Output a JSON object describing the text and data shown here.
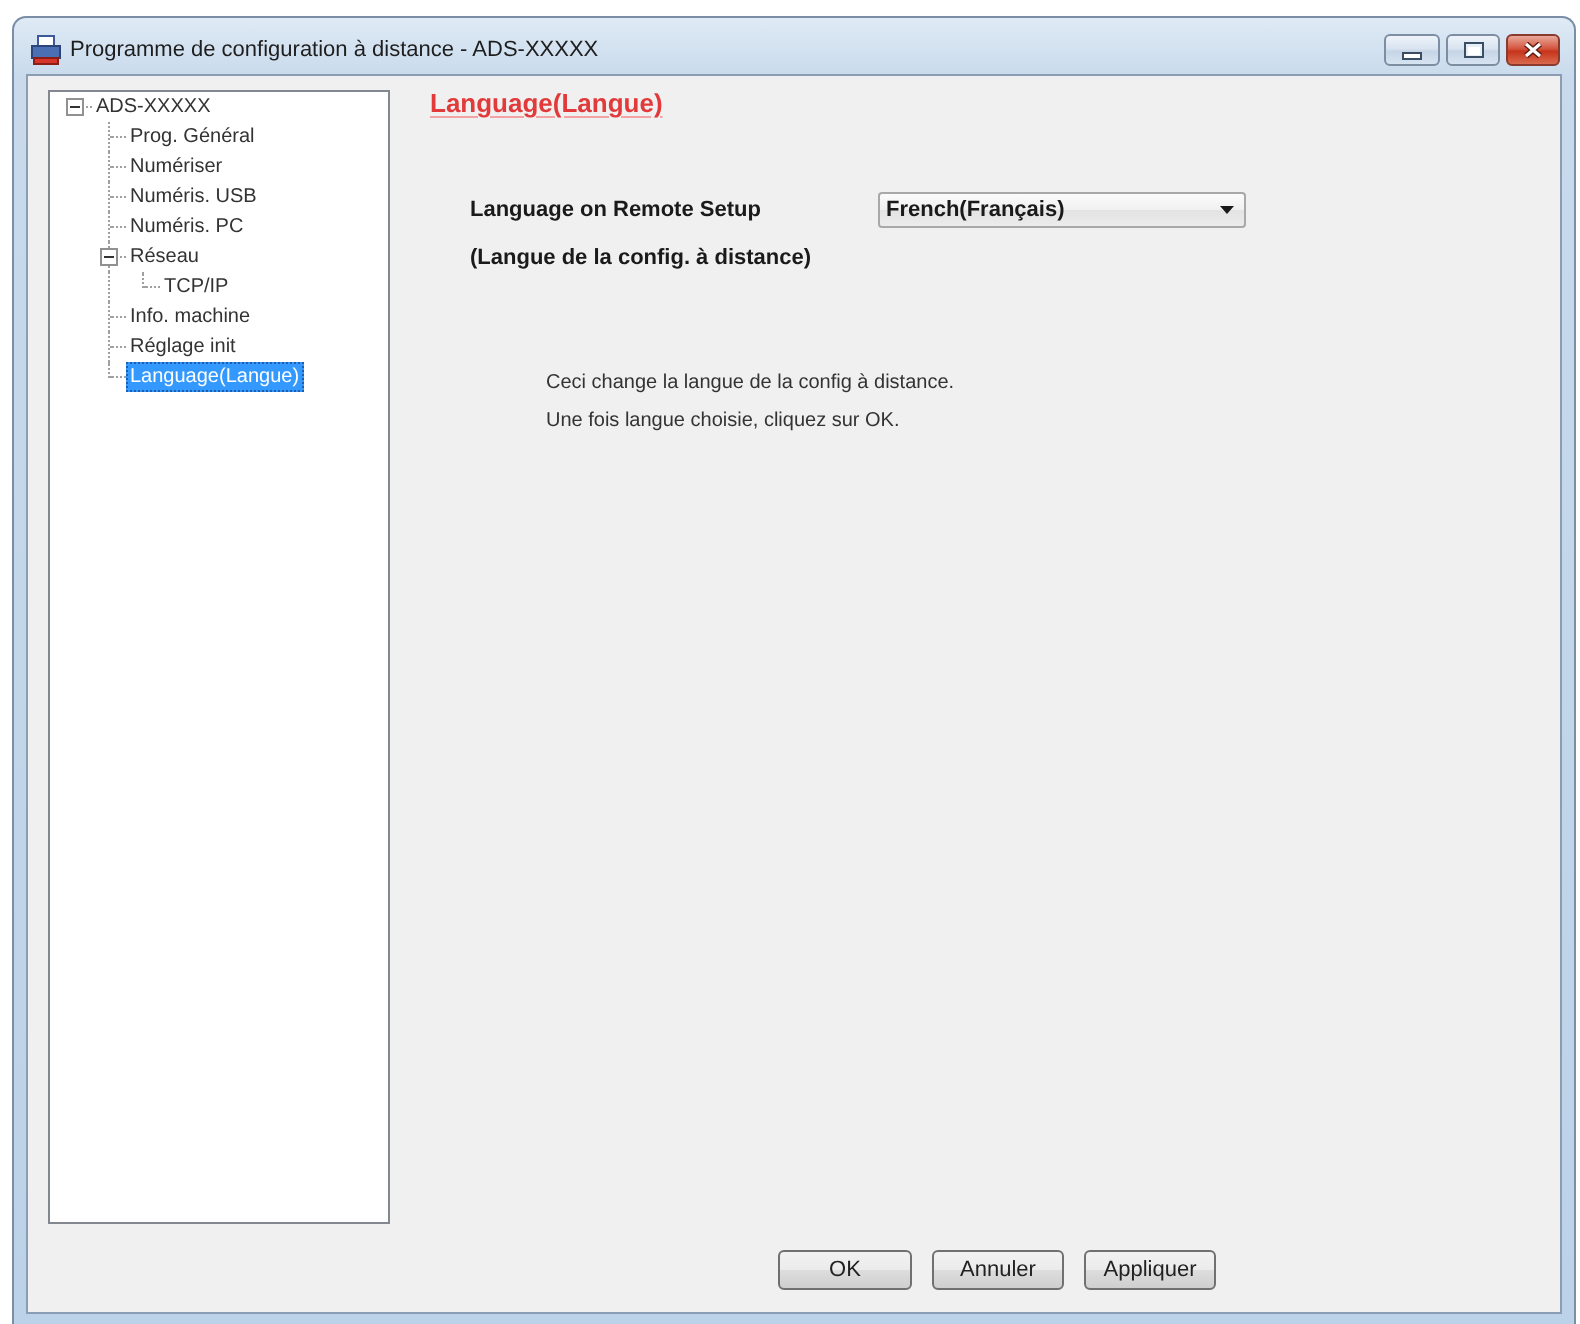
{
  "window": {
    "title": "Programme de configuration à distance - ADS-XXXXX"
  },
  "tree": [
    {
      "label": "ADS-XXXXX",
      "selected": false,
      "expanded": true,
      "children": [
        {
          "label": "Prog. Général",
          "selected": false
        },
        {
          "label": "Numériser",
          "selected": false
        },
        {
          "label": "Numéris. USB",
          "selected": false
        },
        {
          "label": "Numéris. PC",
          "selected": false
        },
        {
          "label": "Réseau",
          "selected": false,
          "expanded": true,
          "children": [
            {
              "label": "TCP/IP",
              "selected": false
            }
          ]
        },
        {
          "label": "Info. machine",
          "selected": false
        },
        {
          "label": "Réglage init",
          "selected": false
        },
        {
          "label": "Language(Langue)",
          "selected": true
        }
      ]
    }
  ],
  "page": {
    "title": "Language(Langue)",
    "setting": {
      "label": "Language on Remote Setup",
      "sublabel": "(Langue de la config. à distance)",
      "value": "French(Français)"
    },
    "notes": [
      "Ceci change la langue de la config à distance.",
      "Une fois langue choisie, cliquez sur OK."
    ]
  },
  "buttons": [
    {
      "label": "OK"
    },
    {
      "label": "Annuler"
    },
    {
      "label": "Appliquer"
    }
  ]
}
